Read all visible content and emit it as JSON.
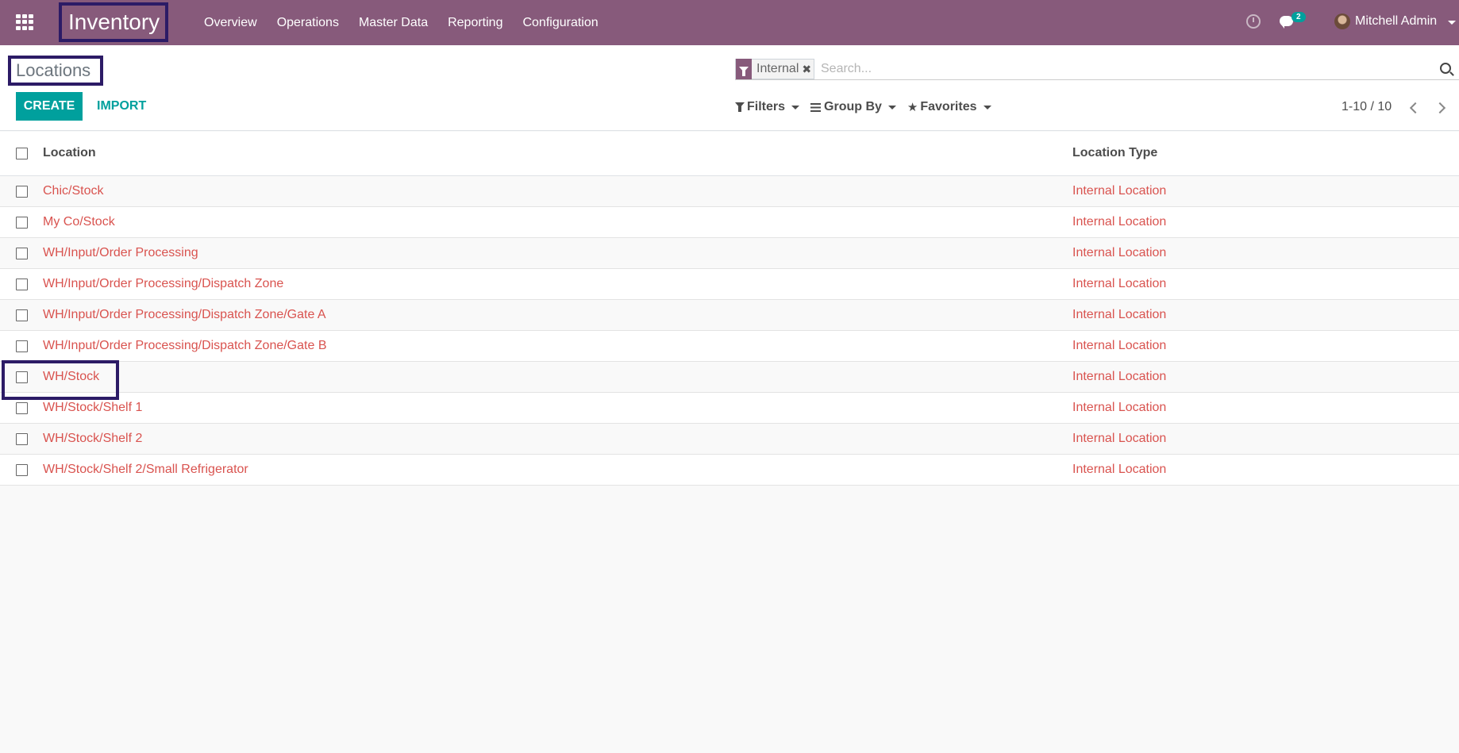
{
  "navbar": {
    "app_name": "Inventory",
    "menu": [
      "Overview",
      "Operations",
      "Master Data",
      "Reporting",
      "Configuration"
    ],
    "chat_count": "2",
    "user_name": "Mitchell Admin",
    "colors": {
      "bar": "#875a7b",
      "accent": "#00a09d",
      "highlight": "#2c1b66"
    }
  },
  "control_panel": {
    "breadcrumb": "Locations",
    "search": {
      "facet_label": "Internal",
      "facet_remove": "✖",
      "placeholder": "Search..."
    },
    "create_label": "CREATE",
    "import_label": "IMPORT",
    "filters_label": "Filters",
    "groupby_label": "Group By",
    "favorites_label": "Favorites",
    "pager": "1-10 / 10"
  },
  "list": {
    "columns": [
      "Location",
      "Location Type"
    ],
    "rows": [
      {
        "location": "Chic/Stock",
        "type": "Internal Location"
      },
      {
        "location": "My Co/Stock",
        "type": "Internal Location"
      },
      {
        "location": "WH/Input/Order Processing",
        "type": "Internal Location"
      },
      {
        "location": "WH/Input/Order Processing/Dispatch Zone",
        "type": "Internal Location"
      },
      {
        "location": "WH/Input/Order Processing/Dispatch Zone/Gate A",
        "type": "Internal Location"
      },
      {
        "location": "WH/Input/Order Processing/Dispatch Zone/Gate B",
        "type": "Internal Location"
      },
      {
        "location": "WH/Stock",
        "type": "Internal Location"
      },
      {
        "location": "WH/Stock/Shelf 1",
        "type": "Internal Location"
      },
      {
        "location": "WH/Stock/Shelf 2",
        "type": "Internal Location"
      },
      {
        "location": "WH/Stock/Shelf 2/Small Refrigerator",
        "type": "Internal Location"
      }
    ]
  }
}
